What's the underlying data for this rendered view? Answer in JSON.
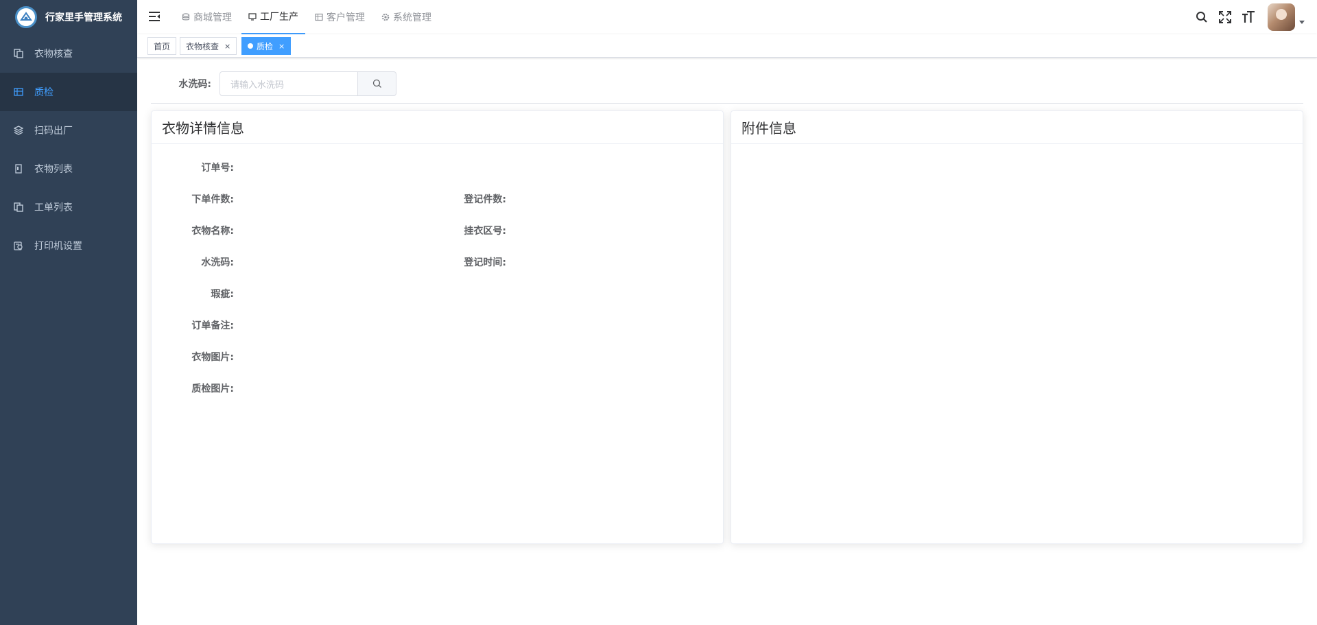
{
  "app": {
    "title": "行家里手管理系统"
  },
  "sidebar": {
    "items": [
      {
        "label": "衣物核查",
        "icon": "documents-icon",
        "active": false
      },
      {
        "label": "质检",
        "icon": "table-icon",
        "active": true
      },
      {
        "label": "扫码出厂",
        "icon": "layers-icon",
        "active": false
      },
      {
        "label": "衣物列表",
        "icon": "list-icon",
        "active": false
      },
      {
        "label": "工单列表",
        "icon": "documents-icon",
        "active": false
      },
      {
        "label": "打印机设置",
        "icon": "printer-icon",
        "active": false
      }
    ]
  },
  "topnav": {
    "items": [
      {
        "label": "商城管理",
        "icon": "database-icon",
        "active": false
      },
      {
        "label": "工厂生产",
        "icon": "monitor-icon",
        "active": true
      },
      {
        "label": "客户管理",
        "icon": "table-icon",
        "active": false
      },
      {
        "label": "系统管理",
        "icon": "gear-icon",
        "active": false
      }
    ]
  },
  "tags": [
    {
      "label": "首页",
      "closable": false,
      "active": false
    },
    {
      "label": "衣物核查",
      "closable": true,
      "active": false
    },
    {
      "label": "质检",
      "closable": true,
      "active": true
    }
  ],
  "search": {
    "label": "水洗码:",
    "placeholder": "请输入水洗码"
  },
  "detail_card": {
    "title": "衣物详情信息",
    "fields": {
      "order_no": "订单号:",
      "order_count": "下单件数:",
      "register_count": "登记件数:",
      "item_name": "衣物名称:",
      "hanging_area": "挂衣区号:",
      "wash_code": "水洗码:",
      "register_time": "登记时间:",
      "defect": "瑕疵:",
      "order_note": "订单备注:",
      "item_images": "衣物图片:",
      "qc_images": "质检图片:"
    }
  },
  "attachment_card": {
    "title": "附件信息"
  },
  "colors": {
    "sidebar_bg": "#304156",
    "sidebar_active_bg": "#263445",
    "accent": "#409eff",
    "sidebar_text": "#bfcbd9"
  }
}
